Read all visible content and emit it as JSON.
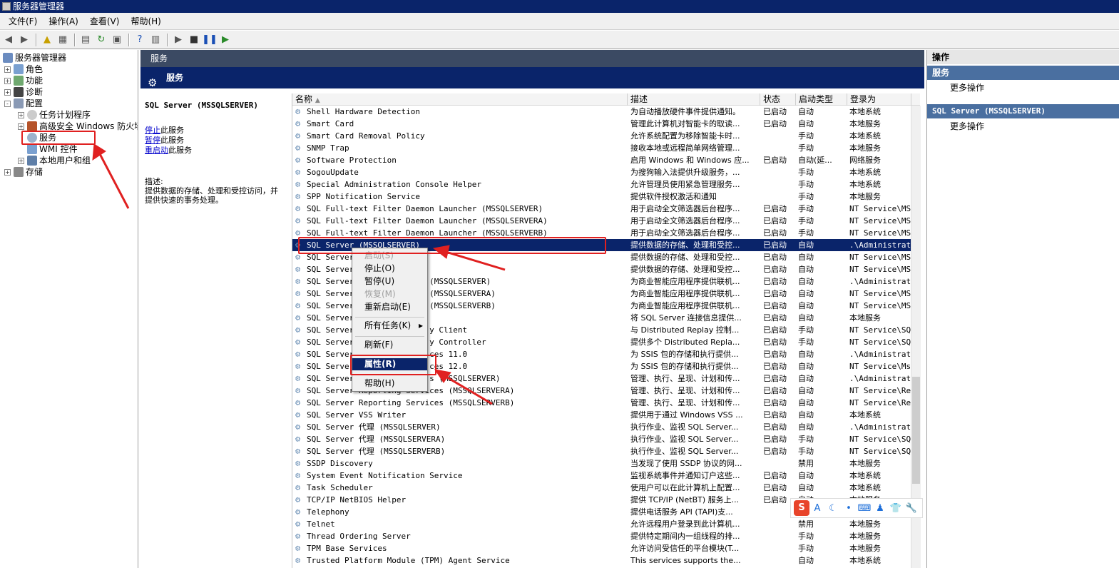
{
  "window": {
    "title": "服务器管理器"
  },
  "menu": [
    "文件(F)",
    "操作(A)",
    "查看(V)",
    "帮助(H)"
  ],
  "tree": {
    "root": "服务器管理器",
    "items": [
      {
        "label": "角色",
        "level": 1,
        "expand": "+"
      },
      {
        "label": "功能",
        "level": 1,
        "expand": "+"
      },
      {
        "label": "诊断",
        "level": 1,
        "expand": "+"
      },
      {
        "label": "配置",
        "level": 1,
        "expand": "-"
      },
      {
        "label": "任务计划程序",
        "level": 2,
        "expand": "+"
      },
      {
        "label": "高级安全 Windows 防火墙",
        "level": 2,
        "expand": "+"
      },
      {
        "label": "服务",
        "level": 2,
        "expand": ""
      },
      {
        "label": "WMI 控件",
        "level": 2,
        "expand": ""
      },
      {
        "label": "本地用户和组",
        "level": 2,
        "expand": "+"
      },
      {
        "label": "存储",
        "level": 1,
        "expand": "+"
      }
    ]
  },
  "center": {
    "header": "服务",
    "band_title": "服务",
    "selected_service": "SQL Server (MSSQLSERVER)",
    "links": {
      "stop_a": "停止",
      "stop_b": "此服务",
      "pause_a": "暂停",
      "pause_b": "此服务",
      "restart_a": "重启动",
      "restart_b": "此服务"
    },
    "desc_label": "描述:",
    "desc_text": "提供数据的存储、处理和受控访问，并提供快速的事务处理。"
  },
  "columns": {
    "name": "名称",
    "desc": "描述",
    "state": "状态",
    "start": "启动类型",
    "logon": "登录为"
  },
  "services": [
    {
      "name": "Shell Hardware Detection",
      "desc": "为自动播放硬件事件提供通知。",
      "state": "已启动",
      "start": "自动",
      "logon": "本地系统"
    },
    {
      "name": "Smart Card",
      "desc": "管理此计算机对智能卡的取读...",
      "state": "已启动",
      "start": "自动",
      "logon": "本地服务"
    },
    {
      "name": "Smart Card Removal Policy",
      "desc": "允许系统配置为移除智能卡时...",
      "state": "",
      "start": "手动",
      "logon": "本地系统"
    },
    {
      "name": "SNMP Trap",
      "desc": "接收本地或远程简单网络管理...",
      "state": "",
      "start": "手动",
      "logon": "本地服务"
    },
    {
      "name": "Software Protection",
      "desc": "启用 Windows 和 Windows 应...",
      "state": "已启动",
      "start": "自动(延...",
      "logon": "网络服务"
    },
    {
      "name": "SogouUpdate",
      "desc": "为搜狗输入法提供升级服务，...",
      "state": "",
      "start": "手动",
      "logon": "本地系统"
    },
    {
      "name": "Special Administration Console Helper",
      "desc": "允许管理员使用紧急管理服务...",
      "state": "",
      "start": "手动",
      "logon": "本地系统"
    },
    {
      "name": "SPP Notification Service",
      "desc": "提供软件授权激活和通知",
      "state": "",
      "start": "手动",
      "logon": "本地服务"
    },
    {
      "name": "SQL Full-text Filter Daemon Launcher (MSSQLSERVER)",
      "desc": "用于启动全文筛选器后台程序...",
      "state": "已启动",
      "start": "手动",
      "logon": "NT Service\\MSS"
    },
    {
      "name": "SQL Full-text Filter Daemon Launcher (MSSQLSERVERA)",
      "desc": "用于启动全文筛选器后台程序...",
      "state": "已启动",
      "start": "手动",
      "logon": "NT Service\\MSS"
    },
    {
      "name": "SQL Full-text Filter Daemon Launcher (MSSQLSERVERB)",
      "desc": "用于启动全文筛选器后台程序...",
      "state": "已启动",
      "start": "手动",
      "logon": "NT Service\\MSS"
    },
    {
      "name": "SQL Server (MSSQLSERVER)",
      "desc": "提供数据的存储、处理和受控...",
      "state": "已启动",
      "start": "自动",
      "logon": ".\\Administrato"
    },
    {
      "name": "SQL Server",
      "desc": "提供数据的存储、处理和受控...",
      "state": "已启动",
      "start": "自动",
      "logon": "NT Service\\MSS"
    },
    {
      "name": "SQL Server",
      "desc": "提供数据的存储、处理和受控...",
      "state": "已启动",
      "start": "自动",
      "logon": "NT Service\\MSS"
    },
    {
      "name": "SQL Server                (MSSQLSERVER)",
      "desc": "为商业智能应用程序提供联机...",
      "state": "已启动",
      "start": "自动",
      "logon": ".\\Administrato"
    },
    {
      "name": "SQL Server                (MSSQLSERVERA)",
      "desc": "为商业智能应用程序提供联机...",
      "state": "已启动",
      "start": "自动",
      "logon": "NT Service\\MSO"
    },
    {
      "name": "SQL Server                (MSSQLSERVERB)",
      "desc": "为商业智能应用程序提供联机...",
      "state": "已启动",
      "start": "自动",
      "logon": "NT Service\\MSO"
    },
    {
      "name": "SQL Server",
      "desc": "将 SQL Server 连接信息提供...",
      "state": "已启动",
      "start": "自动",
      "logon": "本地服务"
    },
    {
      "name": "SQL Server                y Client",
      "desc": "与 Distributed Replay 控制...",
      "state": "已启动",
      "start": "手动",
      "logon": "NT Service\\SQL"
    },
    {
      "name": "SQL Server                y Controller",
      "desc": "提供多个 Distributed Repla...",
      "state": "已启动",
      "start": "手动",
      "logon": "NT Service\\SQL"
    },
    {
      "name": "SQL Server                ces 11.0",
      "desc": "为 SSIS 包的存储和执行提供...",
      "state": "已启动",
      "start": "自动",
      "logon": ".\\Administrato"
    },
    {
      "name": "SQL Server                ces 12.0",
      "desc": "为 SSIS 包的存储和执行提供...",
      "state": "已启动",
      "start": "自动",
      "logon": "NT Service\\MsD"
    },
    {
      "name": "SQL Server                s (MSSQLSERVER)",
      "desc": "管理、执行、呈现、计划和传...",
      "state": "已启动",
      "start": "自动",
      "logon": ".\\Administrato"
    },
    {
      "name": "SQL Server Reporting Services (MSSQLSERVERA)",
      "desc": "管理、执行、呈现、计划和传...",
      "state": "已启动",
      "start": "自动",
      "logon": "NT Service\\Rep"
    },
    {
      "name": "SQL Server Reporting Services (MSSQLSERVERB)",
      "desc": "管理、执行、呈现、计划和传...",
      "state": "已启动",
      "start": "自动",
      "logon": "NT Service\\Rep"
    },
    {
      "name": "SQL Server VSS Writer",
      "desc": "提供用于通过 Windows VSS ...",
      "state": "已启动",
      "start": "自动",
      "logon": "本地系统"
    },
    {
      "name": "SQL Server 代理 (MSSQLSERVER)",
      "desc": "执行作业、监视 SQL Server...",
      "state": "已启动",
      "start": "自动",
      "logon": ".\\Administrato"
    },
    {
      "name": "SQL Server 代理 (MSSQLSERVERA)",
      "desc": "执行作业、监视 SQL Server...",
      "state": "已启动",
      "start": "手动",
      "logon": "NT Service\\SQL"
    },
    {
      "name": "SQL Server 代理 (MSSQLSERVERB)",
      "desc": "执行作业、监视 SQL Server...",
      "state": "已启动",
      "start": "手动",
      "logon": "NT Service\\SQL"
    },
    {
      "name": "SSDP Discovery",
      "desc": "当发现了使用 SSDP 协议的网...",
      "state": "",
      "start": "禁用",
      "logon": "本地服务"
    },
    {
      "name": "System Event Notification Service",
      "desc": "监视系统事件并通知订户这些...",
      "state": "已启动",
      "start": "自动",
      "logon": "本地系统"
    },
    {
      "name": "Task Scheduler",
      "desc": "使用户可以在此计算机上配置...",
      "state": "已启动",
      "start": "自动",
      "logon": "本地系统"
    },
    {
      "name": "TCP/IP NetBIOS Helper",
      "desc": "提供 TCP/IP (NetBT) 服务上...",
      "state": "已启动",
      "start": "自动",
      "logon": "本地服务"
    },
    {
      "name": "Telephony",
      "desc": "提供电话服务 API (TAPI)支...",
      "state": "",
      "start": "",
      "logon": ""
    },
    {
      "name": "Telnet",
      "desc": "允许远程用户登录到此计算机...",
      "state": "",
      "start": "禁用",
      "logon": "本地服务"
    },
    {
      "name": "Thread Ordering Server",
      "desc": "提供特定期间内一组线程的排...",
      "state": "",
      "start": "手动",
      "logon": "本地服务"
    },
    {
      "name": "TPM Base Services",
      "desc": "允许访问受信任的平台模块(T...",
      "state": "",
      "start": "手动",
      "logon": "本地服务"
    },
    {
      "name": "Trusted Platform Module (TPM) Agent Service",
      "desc": "This services supports the...",
      "state": "",
      "start": "自动",
      "logon": "本地系统"
    }
  ],
  "context_menu": [
    {
      "label": "启动(S)",
      "disabled": true
    },
    {
      "label": "停止(O)",
      "disabled": false
    },
    {
      "label": "暂停(U)",
      "disabled": false
    },
    {
      "label": "恢复(M)",
      "disabled": true
    },
    {
      "label": "重新启动(E)",
      "disabled": false
    },
    {
      "label": "所有任务(K)",
      "disabled": false,
      "submenu": "▸"
    },
    {
      "label": "刷新(F)",
      "disabled": false
    },
    {
      "label": "属性(R)",
      "disabled": false,
      "highlighted": true
    },
    {
      "label": "帮助(H)",
      "disabled": false
    }
  ],
  "actions": {
    "header": "操作",
    "group1": "服务",
    "more1": "更多操作",
    "group2": "SQL Server (MSSQLSERVER)",
    "more2": "更多操作"
  },
  "ime": {
    "logo": "S",
    "items": [
      "A",
      "☾",
      "•",
      "⌨",
      "♟",
      "👕",
      "🔧"
    ]
  },
  "colors": {
    "title_bar": "#0a246a",
    "selection": "#0a246a",
    "annotation": "#e02020"
  }
}
